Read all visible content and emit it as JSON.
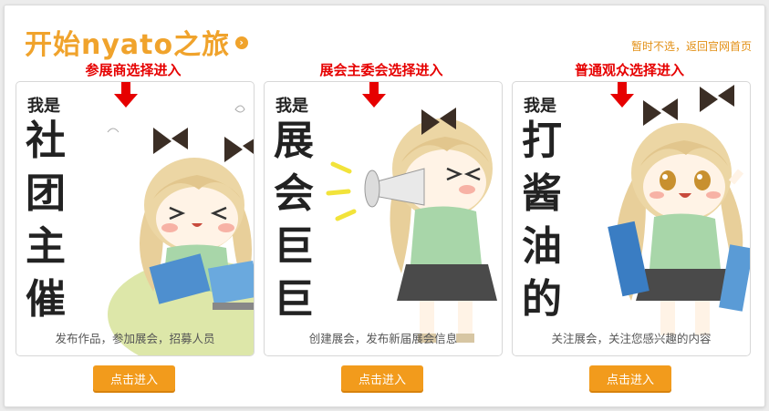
{
  "header": {
    "title": "开始nyato之旅",
    "title_arrow": "›",
    "skip_link": "暂时不选，返回官网首页"
  },
  "cards": [
    {
      "choice_label": "参展商选择进入",
      "iam": "我是",
      "big_chars": [
        "社",
        "团",
        "主",
        "催"
      ],
      "description": "发布作品，参加展会，招募人员",
      "button": "点击进入"
    },
    {
      "choice_label": "展会主委会选择进入",
      "iam": "我是",
      "big_chars": [
        "展",
        "会",
        "巨",
        "巨"
      ],
      "description": "创建展会，发布新届展会信息",
      "button": "点击进入"
    },
    {
      "choice_label": "普通观众选择进入",
      "iam": "我是",
      "big_chars": [
        "打",
        "酱",
        "油",
        "的"
      ],
      "description": "关注展会，关注您感兴趣的内容",
      "button": "点击进入"
    }
  ],
  "colors": {
    "accent": "#f0a32c",
    "choice_red": "#e60000",
    "button": "#f29b1c"
  }
}
